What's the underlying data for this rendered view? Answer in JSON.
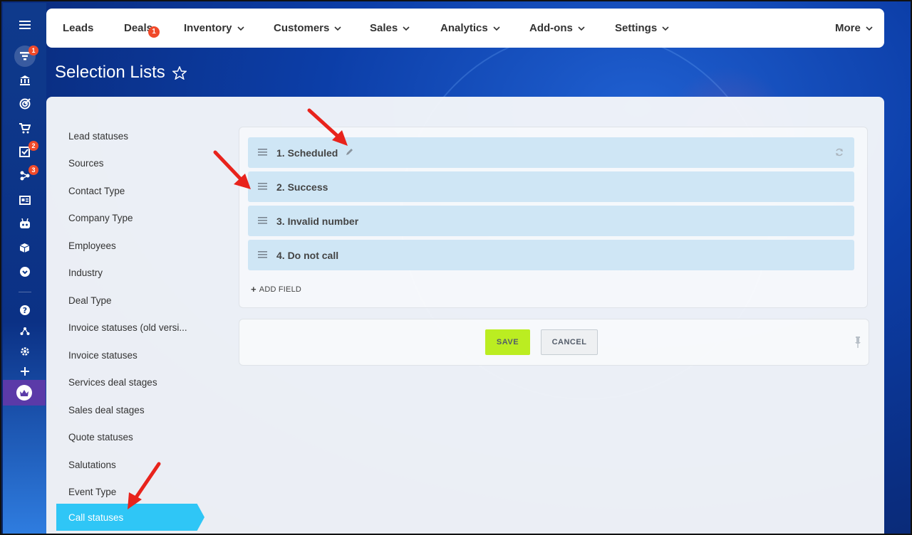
{
  "topnav": {
    "items": [
      {
        "label": "Leads",
        "dropdown": false
      },
      {
        "label": "Deals",
        "dropdown": false,
        "badge": "1"
      },
      {
        "label": "Inventory",
        "dropdown": true
      },
      {
        "label": "Customers",
        "dropdown": true
      },
      {
        "label": "Sales",
        "dropdown": true
      },
      {
        "label": "Analytics",
        "dropdown": true
      },
      {
        "label": "Add-ons",
        "dropdown": true
      },
      {
        "label": "Settings",
        "dropdown": true
      },
      {
        "label": "More",
        "dropdown": true
      }
    ]
  },
  "rail": {
    "badges": {
      "funnel": "1",
      "tasks": "2",
      "network": "3"
    },
    "icons": [
      "menu-icon",
      "funnel-icon",
      "bank-icon",
      "target-icon",
      "cart-icon",
      "tasks-icon",
      "network-icon",
      "contact-card-icon",
      "robot-icon",
      "box-icon",
      "chevron-circle-icon",
      "help-icon",
      "sitemap-icon",
      "gear-icon",
      "plus-icon",
      "crown-icon"
    ]
  },
  "page": {
    "title": "Selection Lists"
  },
  "sidebar": {
    "items": [
      {
        "label": "Lead statuses"
      },
      {
        "label": "Sources"
      },
      {
        "label": "Contact Type"
      },
      {
        "label": "Company Type"
      },
      {
        "label": "Employees"
      },
      {
        "label": "Industry"
      },
      {
        "label": "Deal Type"
      },
      {
        "label": "Invoice statuses (old versi..."
      },
      {
        "label": "Invoice statuses"
      },
      {
        "label": "Services deal stages"
      },
      {
        "label": "Sales deal stages"
      },
      {
        "label": "Quote statuses"
      },
      {
        "label": "Salutations"
      },
      {
        "label": "Event Type"
      },
      {
        "label": "Call statuses",
        "active": true
      }
    ]
  },
  "fields": {
    "items": [
      {
        "label": "1. Scheduled"
      },
      {
        "label": "2. Success"
      },
      {
        "label": "3. Invalid number"
      },
      {
        "label": "4. Do not call"
      }
    ],
    "add_label": "ADD FIELD"
  },
  "actions": {
    "save_label": "SAVE",
    "cancel_label": "CANCEL"
  },
  "colors": {
    "accent": "#2fc6f6",
    "save": "#bbed21",
    "badge": "#f04a2a",
    "arrow": "#e8231c",
    "field_bg": "#cfe6f5"
  }
}
